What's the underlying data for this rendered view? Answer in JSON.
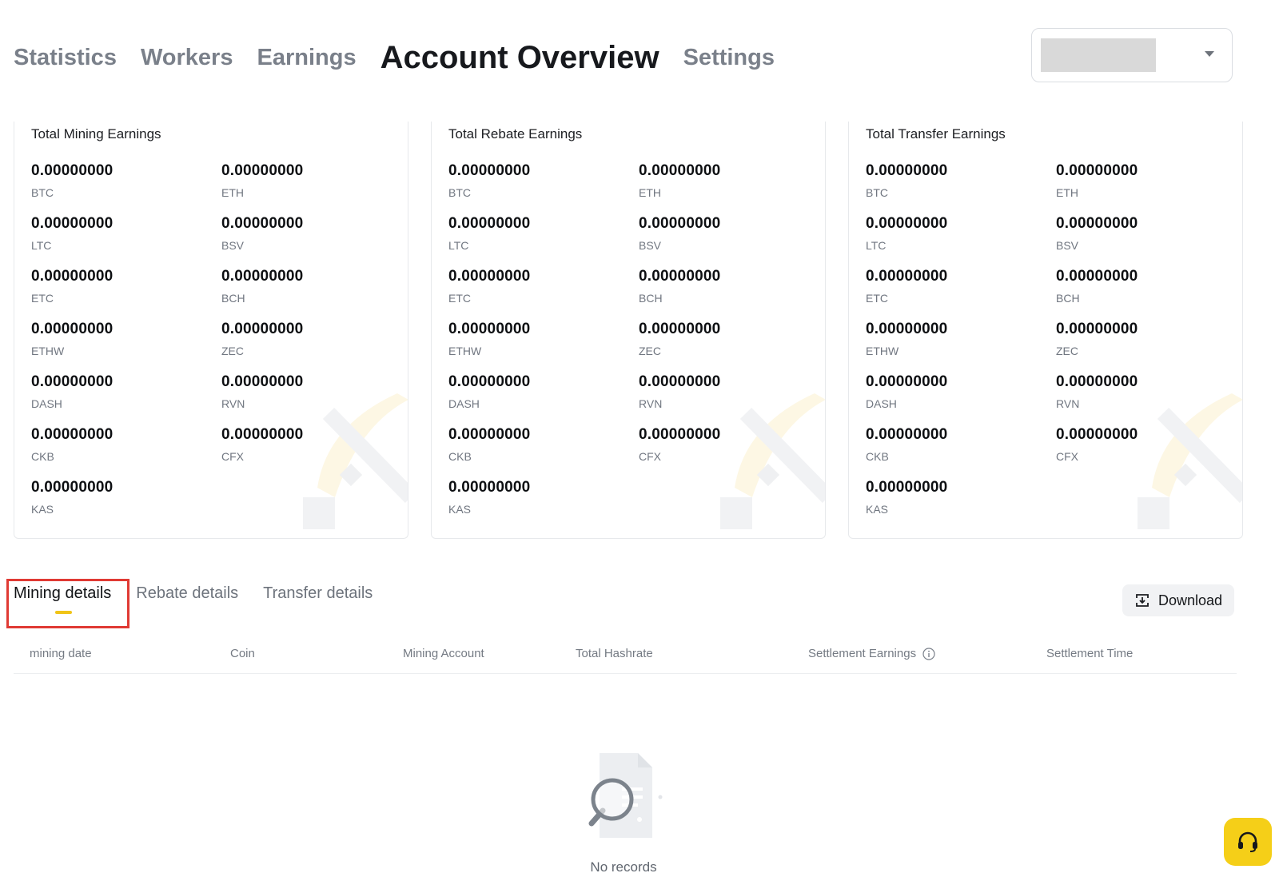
{
  "nav": {
    "tabs": [
      {
        "label": "Statistics",
        "active": false
      },
      {
        "label": "Workers",
        "active": false
      },
      {
        "label": "Earnings",
        "active": false
      },
      {
        "label": "Account Overview",
        "active": true
      },
      {
        "label": "Settings",
        "active": false
      }
    ]
  },
  "account_select": {
    "value": ""
  },
  "cards": [
    {
      "title": "Total Mining Earnings",
      "items": [
        {
          "amount": "0.00000000",
          "coin": "BTC"
        },
        {
          "amount": "0.00000000",
          "coin": "ETH"
        },
        {
          "amount": "0.00000000",
          "coin": "LTC"
        },
        {
          "amount": "0.00000000",
          "coin": "BSV"
        },
        {
          "amount": "0.00000000",
          "coin": "ETC"
        },
        {
          "amount": "0.00000000",
          "coin": "BCH"
        },
        {
          "amount": "0.00000000",
          "coin": "ETHW"
        },
        {
          "amount": "0.00000000",
          "coin": "ZEC"
        },
        {
          "amount": "0.00000000",
          "coin": "DASH"
        },
        {
          "amount": "0.00000000",
          "coin": "RVN"
        },
        {
          "amount": "0.00000000",
          "coin": "CKB"
        },
        {
          "amount": "0.00000000",
          "coin": "CFX"
        },
        {
          "amount": "0.00000000",
          "coin": "KAS"
        }
      ]
    },
    {
      "title": "Total Rebate Earnings",
      "items": [
        {
          "amount": "0.00000000",
          "coin": "BTC"
        },
        {
          "amount": "0.00000000",
          "coin": "ETH"
        },
        {
          "amount": "0.00000000",
          "coin": "LTC"
        },
        {
          "amount": "0.00000000",
          "coin": "BSV"
        },
        {
          "amount": "0.00000000",
          "coin": "ETC"
        },
        {
          "amount": "0.00000000",
          "coin": "BCH"
        },
        {
          "amount": "0.00000000",
          "coin": "ETHW"
        },
        {
          "amount": "0.00000000",
          "coin": "ZEC"
        },
        {
          "amount": "0.00000000",
          "coin": "DASH"
        },
        {
          "amount": "0.00000000",
          "coin": "RVN"
        },
        {
          "amount": "0.00000000",
          "coin": "CKB"
        },
        {
          "amount": "0.00000000",
          "coin": "CFX"
        },
        {
          "amount": "0.00000000",
          "coin": "KAS"
        }
      ]
    },
    {
      "title": "Total Transfer Earnings",
      "items": [
        {
          "amount": "0.00000000",
          "coin": "BTC"
        },
        {
          "amount": "0.00000000",
          "coin": "ETH"
        },
        {
          "amount": "0.00000000",
          "coin": "LTC"
        },
        {
          "amount": "0.00000000",
          "coin": "BSV"
        },
        {
          "amount": "0.00000000",
          "coin": "ETC"
        },
        {
          "amount": "0.00000000",
          "coin": "BCH"
        },
        {
          "amount": "0.00000000",
          "coin": "ETHW"
        },
        {
          "amount": "0.00000000",
          "coin": "ZEC"
        },
        {
          "amount": "0.00000000",
          "coin": "DASH"
        },
        {
          "amount": "0.00000000",
          "coin": "RVN"
        },
        {
          "amount": "0.00000000",
          "coin": "CKB"
        },
        {
          "amount": "0.00000000",
          "coin": "CFX"
        },
        {
          "amount": "0.00000000",
          "coin": "KAS"
        }
      ]
    }
  ],
  "detail_tabs": [
    {
      "label": "Mining details",
      "active": true
    },
    {
      "label": "Rebate details",
      "active": false
    },
    {
      "label": "Transfer details",
      "active": false
    }
  ],
  "download": {
    "label": "Download",
    "icon": "download-icon"
  },
  "table": {
    "columns": [
      "mining date",
      "Coin",
      "Mining Account",
      "Total Hashrate",
      "Settlement Earnings",
      "Settlement Time"
    ],
    "empty_text": "No records"
  },
  "colors": {
    "accent": "#f0c418",
    "highlight": "#e03a34",
    "support": "#f5cf18"
  }
}
